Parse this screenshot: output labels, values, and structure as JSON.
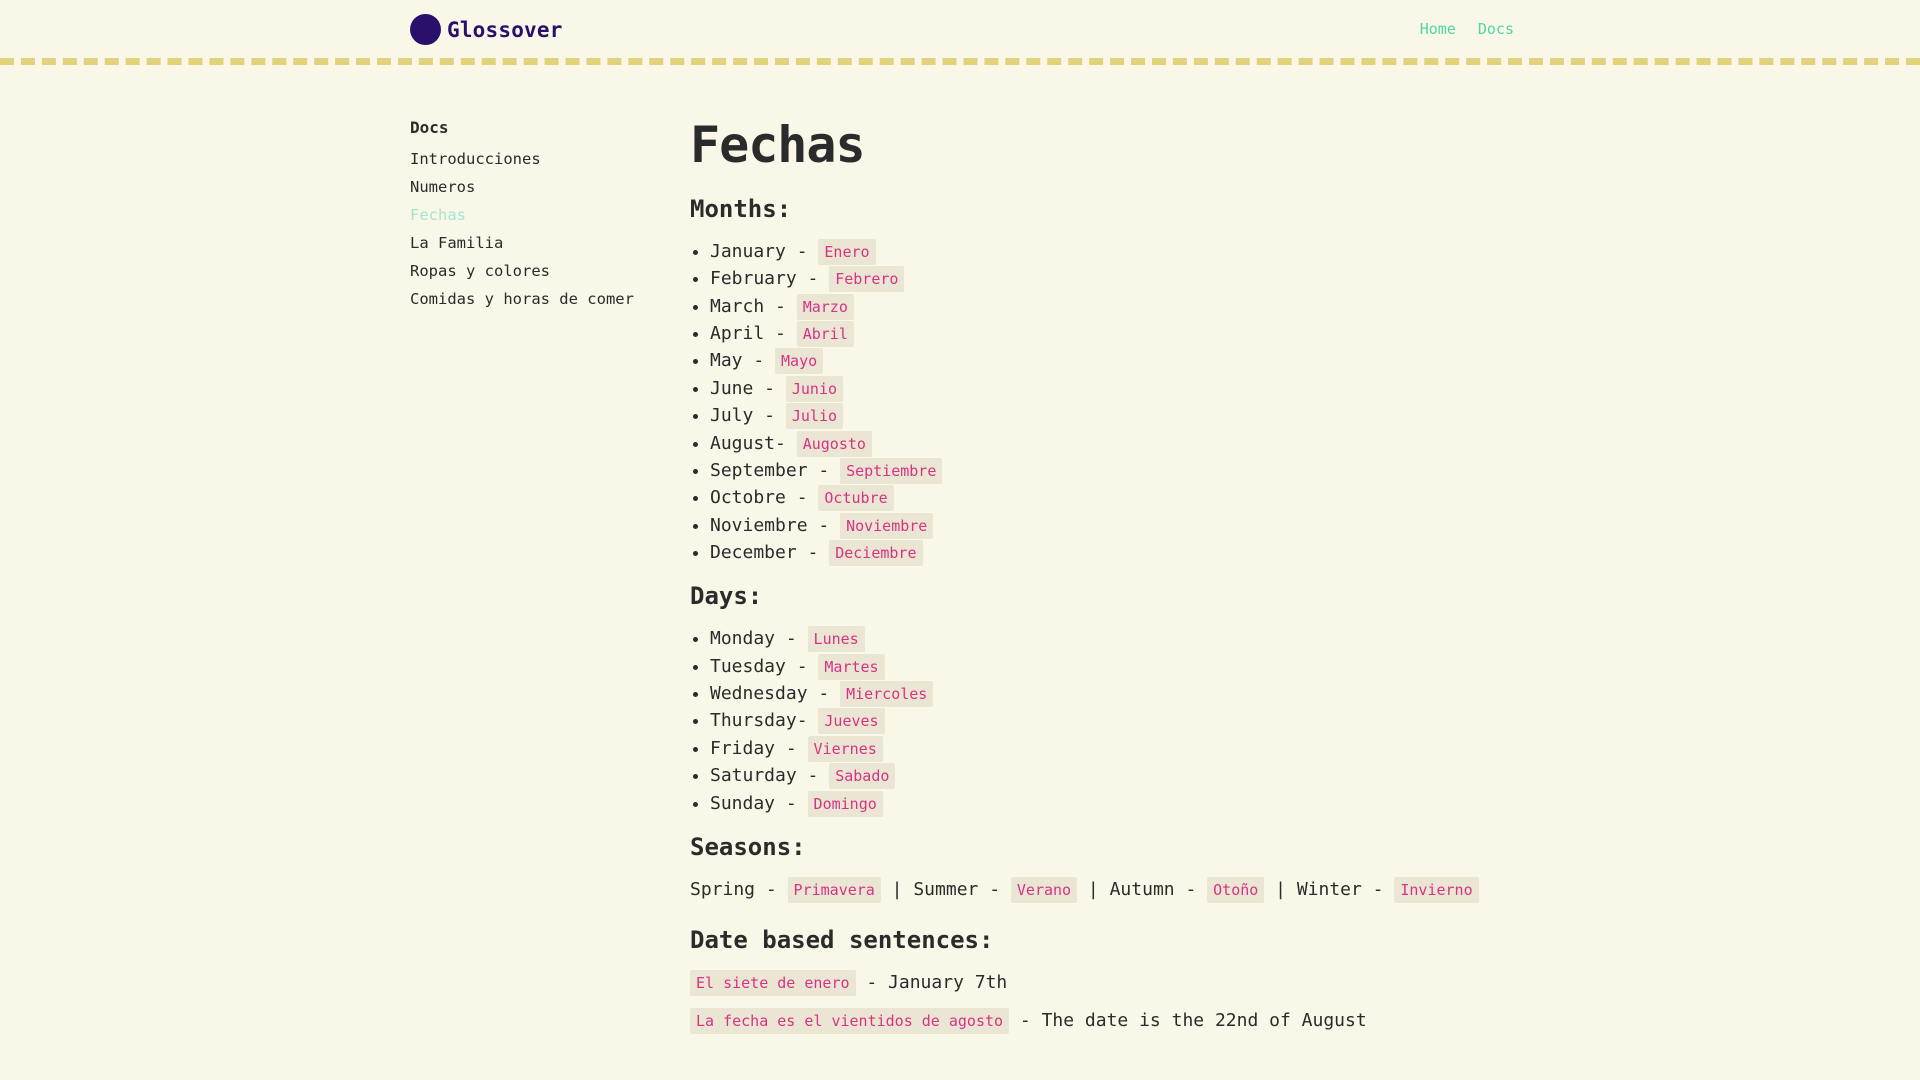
{
  "header": {
    "brand": "Glossover",
    "nav": [
      "Home",
      "Docs"
    ]
  },
  "sidebar": {
    "title": "Docs",
    "items": [
      {
        "label": "Introducciones",
        "active": false
      },
      {
        "label": "Numeros",
        "active": false
      },
      {
        "label": "Fechas",
        "active": true
      },
      {
        "label": "La Familia",
        "active": false
      },
      {
        "label": "Ropas y colores",
        "active": false
      },
      {
        "label": "Comidas y horas de comer",
        "active": false
      }
    ]
  },
  "page": {
    "title": "Fechas",
    "months_heading": "Months:",
    "months": [
      {
        "en": "January -",
        "es": "Enero"
      },
      {
        "en": "February -",
        "es": "Febrero"
      },
      {
        "en": "March -",
        "es": "Marzo"
      },
      {
        "en": "April -",
        "es": "Abril"
      },
      {
        "en": "May -",
        "es": "Mayo"
      },
      {
        "en": "June -",
        "es": "Junio"
      },
      {
        "en": "July -",
        "es": "Julio"
      },
      {
        "en": "August-",
        "es": "Augosto"
      },
      {
        "en": "September -",
        "es": "Septiembre"
      },
      {
        "en": "Octobre -",
        "es": "Octubre"
      },
      {
        "en": "Noviembre -",
        "es": "Noviembre"
      },
      {
        "en": "December -",
        "es": "Deciembre"
      }
    ],
    "days_heading": "Days:",
    "days": [
      {
        "en": "Monday -",
        "es": "Lunes"
      },
      {
        "en": "Tuesday -",
        "es": "Martes"
      },
      {
        "en": "Wednesday -",
        "es": "Miercoles"
      },
      {
        "en": "Thursday-",
        "es": "Jueves"
      },
      {
        "en": "Friday -",
        "es": "Viernes"
      },
      {
        "en": "Saturday -",
        "es": "Sabado"
      },
      {
        "en": "Sunday -",
        "es": "Domingo"
      }
    ],
    "seasons_heading": "Seasons:",
    "seasons": [
      {
        "en": "Spring -",
        "es": "Primavera"
      },
      {
        "en": "| Summer -",
        "es": "Verano"
      },
      {
        "en": "| Autumn -",
        "es": "Otoño"
      },
      {
        "en": "| Winter -",
        "es": "Invierno"
      }
    ],
    "sentences_heading": "Date based sentences:",
    "sentences": [
      {
        "es": "El siete de enero",
        "en": "- January 7th"
      },
      {
        "es": "La fecha es el vientidos de agosto",
        "en": "- The date is the 22nd of August"
      }
    ]
  },
  "colors": {
    "background": "#f8f7e8",
    "brand": "#2a0f6b",
    "link": "#4fd6a5",
    "active": "#a6e6cf",
    "code_text": "#d63384",
    "code_bg": "#ebe6d3",
    "divider": "#e3d27c"
  }
}
